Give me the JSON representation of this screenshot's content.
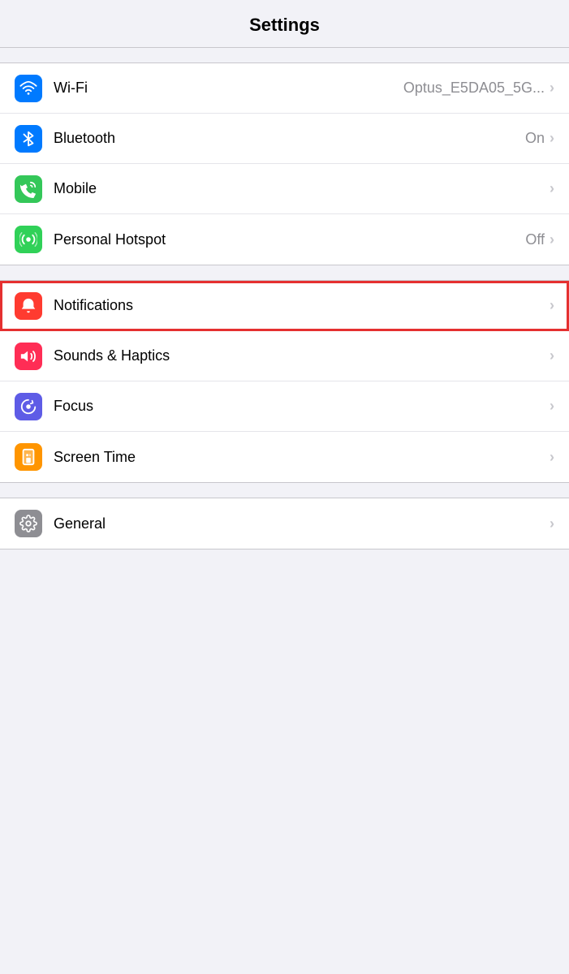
{
  "header": {
    "title": "Settings"
  },
  "sections": [
    {
      "id": "connectivity",
      "rows": [
        {
          "id": "wifi",
          "label": "Wi-Fi",
          "value": "Optus_E5DA05_5G...",
          "icon_color": "icon-blue",
          "icon_type": "wifi",
          "show_chevron": true
        },
        {
          "id": "bluetooth",
          "label": "Bluetooth",
          "value": "On",
          "icon_color": "icon-blue-dark",
          "icon_type": "bluetooth",
          "show_chevron": true
        },
        {
          "id": "mobile",
          "label": "Mobile",
          "value": "",
          "icon_color": "icon-green",
          "icon_type": "mobile",
          "show_chevron": true
        },
        {
          "id": "hotspot",
          "label": "Personal Hotspot",
          "value": "Off",
          "icon_color": "icon-green2",
          "icon_type": "hotspot",
          "show_chevron": true
        }
      ]
    },
    {
      "id": "notifications-section",
      "rows": [
        {
          "id": "notifications",
          "label": "Notifications",
          "value": "",
          "icon_color": "icon-red",
          "icon_type": "notifications",
          "show_chevron": true,
          "highlighted": true
        },
        {
          "id": "sounds",
          "label": "Sounds & Haptics",
          "value": "",
          "icon_color": "icon-pink",
          "icon_type": "sounds",
          "show_chevron": true
        },
        {
          "id": "focus",
          "label": "Focus",
          "value": "",
          "icon_color": "icon-purple",
          "icon_type": "focus",
          "show_chevron": true
        },
        {
          "id": "screentime",
          "label": "Screen Time",
          "value": "",
          "icon_color": "icon-yellow",
          "icon_type": "screentime",
          "show_chevron": true
        }
      ]
    },
    {
      "id": "general-section",
      "rows": [
        {
          "id": "general",
          "label": "General",
          "value": "",
          "icon_color": "icon-gray",
          "icon_type": "general",
          "show_chevron": true
        }
      ]
    }
  ]
}
